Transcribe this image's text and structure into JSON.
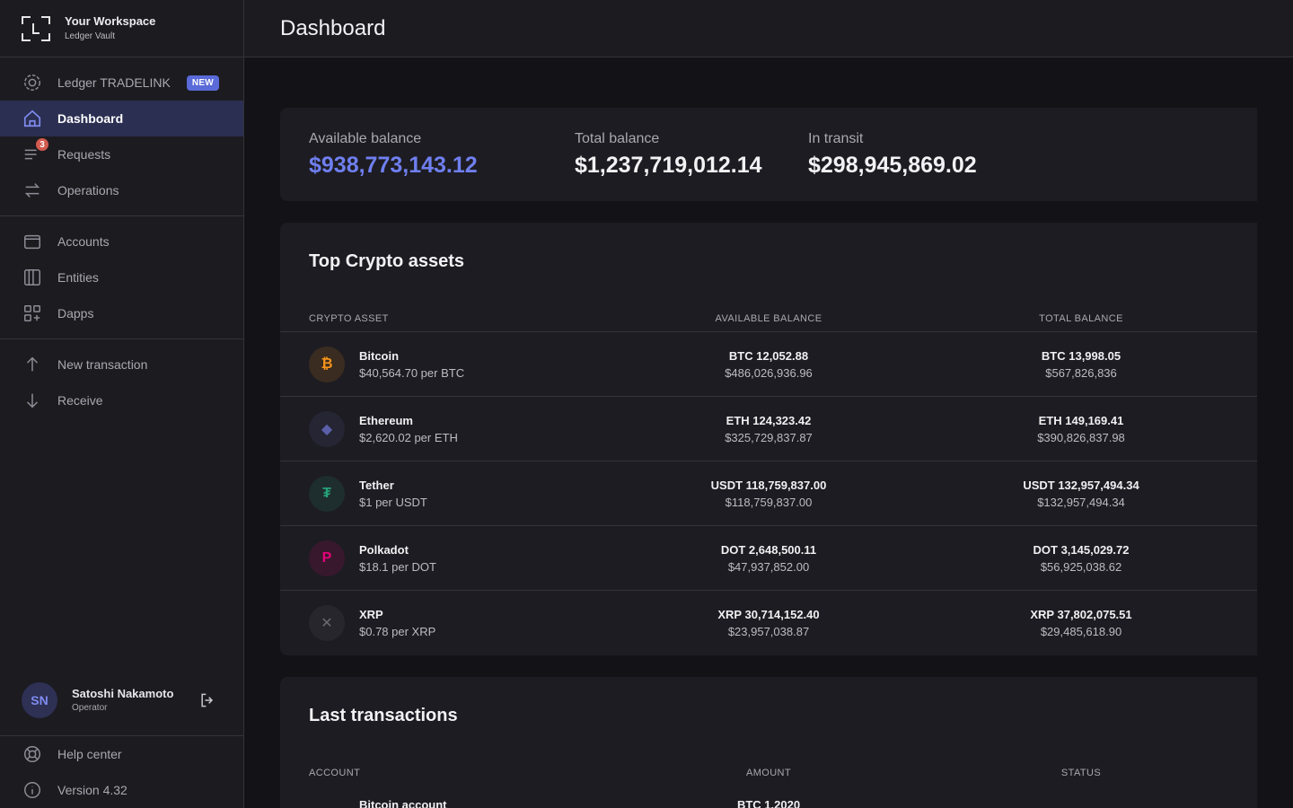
{
  "workspace": {
    "title": "Your Workspace",
    "subtitle": "Ledger Vault"
  },
  "nav": {
    "tradelink": {
      "label": "Ledger TRADELINK",
      "badge": "NEW"
    },
    "dashboard": {
      "label": "Dashboard"
    },
    "requests": {
      "label": "Requests",
      "count": "3"
    },
    "operations": {
      "label": "Operations"
    },
    "accounts": {
      "label": "Accounts"
    },
    "entities": {
      "label": "Entities"
    },
    "dapps": {
      "label": "Dapps"
    },
    "new_transaction": {
      "label": "New transaction"
    },
    "receive": {
      "label": "Receive"
    }
  },
  "user": {
    "initials": "SN",
    "name": "Satoshi Nakamoto",
    "role": "Operator"
  },
  "bottom": {
    "help": "Help center",
    "version": "Version 4.32"
  },
  "header": {
    "title": "Dashboard"
  },
  "balances": {
    "available": {
      "label": "Available balance",
      "value": "$938,773,143.12"
    },
    "total": {
      "label": "Total balance",
      "value": "$1,237,719,012.14"
    },
    "transit": {
      "label": "In transit",
      "value": "$298,945,869.02"
    }
  },
  "assets": {
    "title": "Top Crypto assets",
    "columns": {
      "asset": "CRYPTO ASSET",
      "available": "AVAILABLE BALANCE",
      "total": "TOTAL BALANCE"
    },
    "rows": [
      {
        "name": "Bitcoin",
        "price": "$40,564.70 per BTC",
        "avail_crypto": "BTC 12,052.88",
        "avail_fiat": "$486,026,936.96",
        "total_crypto": "BTC 13,998.05",
        "total_fiat": "$567,826,836",
        "symbol": "₿",
        "color": "#f7931a"
      },
      {
        "name": "Ethereum",
        "price": "$2,620.02 per ETH",
        "avail_crypto": "ETH 124,323.42",
        "avail_fiat": "$325,729,837.87",
        "total_crypto": "ETH 149,169.41",
        "total_fiat": "$390,826,837.98",
        "symbol": "◆",
        "color": "#5b5fa8"
      },
      {
        "name": "Tether",
        "price": "$1 per USDT",
        "avail_crypto": "USDT 118,759,837.00",
        "avail_fiat": "$118,759,837.00",
        "total_crypto": "USDT 132,957,494.34",
        "total_fiat": "$132,957,494.34",
        "symbol": "₮",
        "color": "#26a17b"
      },
      {
        "name": "Polkadot",
        "price": "$18.1 per DOT",
        "avail_crypto": "DOT 2,648,500.11",
        "avail_fiat": "$47,937,852.00",
        "total_crypto": "DOT 3,145,029.72",
        "total_fiat": "$56,925,038.62",
        "symbol": "P",
        "color": "#e6007a"
      },
      {
        "name": "XRP",
        "price": "$0.78 per XRP",
        "avail_crypto": "XRP 30,714,152.40",
        "avail_fiat": "$23,957,038.87",
        "total_crypto": "XRP 37,802,075.51",
        "total_fiat": "$29,485,618.90",
        "symbol": "✕",
        "color": "#6a6a72"
      }
    ]
  },
  "transactions": {
    "title": "Last transactions",
    "columns": {
      "account": "ACCOUNT",
      "amount": "AMOUNT",
      "status": "STATUS"
    },
    "first_row": {
      "account": "Bitcoin account",
      "amount": "BTC 1.2020"
    }
  }
}
